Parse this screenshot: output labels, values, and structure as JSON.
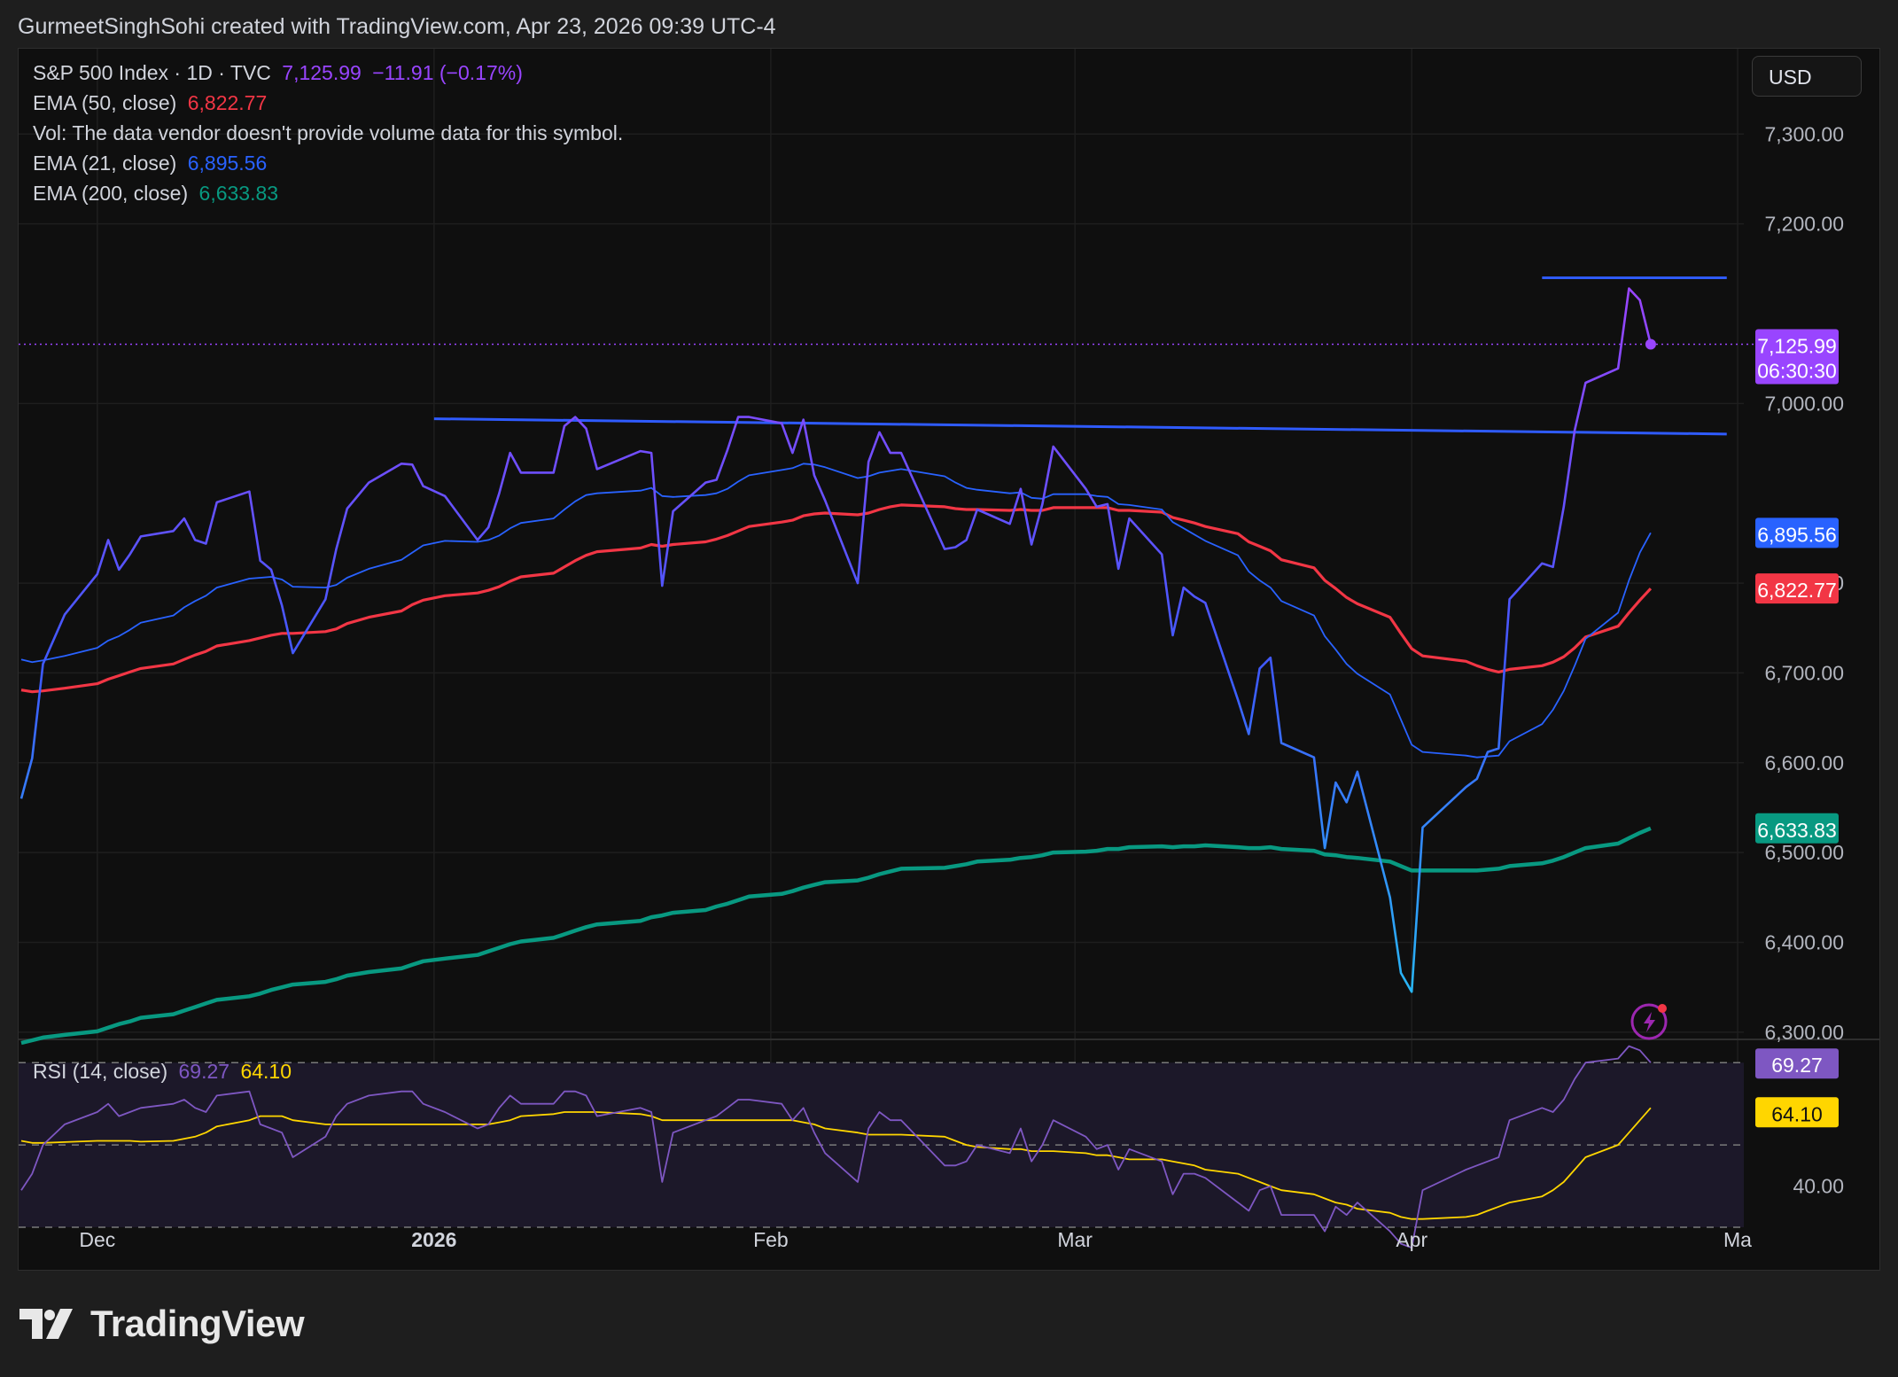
{
  "attribution": "GurmeetSinghSohi created with TradingView.com, Apr 23, 2026 09:39 UTC-4",
  "legend": {
    "symbol": "S&P 500 Index · 1D · TVC",
    "price": "7,125.99",
    "change": "−11.91 (−0.17%)",
    "ema50_label": "EMA (50, close)",
    "ema50_value": "6,822.77",
    "vol_note": "Vol: The data vendor doesn't provide volume data for this symbol.",
    "ema21_label": "EMA (21, close)",
    "ema21_value": "6,895.56",
    "ema200_label": "EMA (200, close)",
    "ema200_value": "6,633.83",
    "rsi_label": "RSI (14, close)",
    "rsi_value": "69.27",
    "rsi_ma_value": "64.10"
  },
  "currency": "USD",
  "price_tags": {
    "last_price": "7,125.99",
    "countdown": "06:30:30",
    "ema21": "6,895.56",
    "ema50": "6,822.77",
    "ema200": "6,633.83",
    "rsi": "69.27",
    "rsi_ma": "64.10"
  },
  "footer_brand": "TradingView",
  "colors": {
    "price": "#9945ff",
    "ema21": "#2962ff",
    "ema50": "#f23645",
    "ema200": "#089981",
    "rsi": "#7e57c2",
    "rsi_ma": "#ffd600",
    "trendline": "#2f5bff"
  },
  "chart_data": [
    {
      "type": "line",
      "title": "S&P 500 Index · 1D · TVC",
      "x": [
        "2025-11-24",
        "2025-11-25",
        "2025-11-26",
        "2025-11-28",
        "2025-12-01",
        "2025-12-02",
        "2025-12-03",
        "2025-12-04",
        "2025-12-05",
        "2025-12-08",
        "2025-12-09",
        "2025-12-10",
        "2025-12-11",
        "2025-12-12",
        "2025-12-15",
        "2025-12-16",
        "2025-12-17",
        "2025-12-18",
        "2025-12-19",
        "2025-12-22",
        "2025-12-23",
        "2025-12-24",
        "2025-12-26",
        "2025-12-29",
        "2025-12-30",
        "2025-12-31",
        "2026-01-02",
        "2026-01-05",
        "2026-01-06",
        "2026-01-07",
        "2026-01-08",
        "2026-01-09",
        "2026-01-12",
        "2026-01-13",
        "2026-01-14",
        "2026-01-15",
        "2026-01-16",
        "2026-01-20",
        "2026-01-21",
        "2026-01-22",
        "2026-01-23",
        "2026-01-26",
        "2026-01-27",
        "2026-01-28",
        "2026-01-29",
        "2026-01-30",
        "2026-02-02",
        "2026-02-03",
        "2026-02-04",
        "2026-02-05",
        "2026-02-06",
        "2026-02-09",
        "2026-02-10",
        "2026-02-11",
        "2026-02-12",
        "2026-02-13",
        "2026-02-17",
        "2026-02-18",
        "2026-02-19",
        "2026-02-20",
        "2026-02-23",
        "2026-02-24",
        "2026-02-25",
        "2026-02-26",
        "2026-02-27",
        "2026-03-02",
        "2026-03-03",
        "2026-03-04",
        "2026-03-05",
        "2026-03-06",
        "2026-03-09",
        "2026-03-10",
        "2026-03-11",
        "2026-03-12",
        "2026-03-13",
        "2026-03-16",
        "2026-03-17",
        "2026-03-18",
        "2026-03-19",
        "2026-03-20",
        "2026-03-23",
        "2026-03-24",
        "2026-03-25",
        "2026-03-26",
        "2026-03-27",
        "2026-03-30",
        "2026-03-31",
        "2026-04-01",
        "2026-04-02",
        "2026-04-06",
        "2026-04-07",
        "2026-04-08",
        "2026-04-09",
        "2026-04-10",
        "2026-04-13",
        "2026-04-14",
        "2026-04-15",
        "2026-04-16",
        "2026-04-17",
        "2026-04-20",
        "2026-04-21",
        "2026-04-22",
        "2026-04-23"
      ],
      "x_ticks": [
        "Dec",
        "2026",
        "Feb",
        "Mar",
        "Apr",
        "Ma"
      ],
      "x_tick_dates": [
        "2025-12-01",
        "2026-01-01",
        "2026-02-01",
        "2026-03-01",
        "2026-04-01",
        "2026-05-01"
      ],
      "x_range": [
        "2025-11-24",
        "2026-05-01"
      ],
      "ylim": [
        6290,
        7395
      ],
      "y_ticks": [
        6300,
        6400,
        6500,
        6600,
        6700,
        6800,
        7000,
        7200,
        7300
      ],
      "y_tick_labels": [
        "6,300.00",
        "6,400.00",
        "6,500.00",
        "6,600.00",
        "6,700.00",
        "6,800.00",
        "7,000.00",
        "7,200.00",
        "7,300.00"
      ],
      "series": [
        {
          "name": "S&P 500 Index",
          "values": [
            6560,
            6605,
            6710,
            6765,
            6810,
            6848,
            6815,
            6832,
            6852,
            6858,
            6872,
            6848,
            6844,
            6890,
            6902,
            6825,
            6815,
            6775,
            6722,
            6782,
            6838,
            6883,
            6912,
            6933,
            6932,
            6908,
            6897,
            6848,
            6862,
            6900,
            6945,
            6923,
            6923,
            6975,
            6985,
            6972,
            6927,
            6947,
            6945,
            6797,
            6880,
            6912,
            6915,
            6948,
            6985,
            6985,
            6978,
            6945,
            6982,
            6920,
            6892,
            6800,
            6935,
            6968,
            6945,
            6945,
            6838,
            6840,
            6848,
            6882,
            6866,
            6905,
            6843,
            6888,
            6952,
            6905,
            6885,
            6888,
            6816,
            6872,
            6832,
            6742,
            6795,
            6785,
            6778,
            6670,
            6632,
            6705,
            6717,
            6622,
            6606,
            6505,
            6578,
            6556,
            6590,
            6450,
            6366,
            6345,
            6528,
            6573,
            6582,
            6612,
            6616,
            6782,
            6822,
            6818,
            6885,
            6970,
            7023,
            7039,
            7128,
            7115,
            7066,
            7137,
            7126
          ],
          "color": "#9945ff"
        },
        {
          "name": "EMA (21, close)",
          "values": [
            6715,
            6712,
            6714,
            6719,
            6728,
            6736,
            6741,
            6748,
            6756,
            6764,
            6773,
            6780,
            6786,
            6795,
            6805,
            6806,
            6807,
            6804,
            6796,
            6795,
            6798,
            6806,
            6816,
            6826,
            6834,
            6842,
            6847,
            6846,
            6848,
            6853,
            6861,
            6867,
            6872,
            6882,
            6891,
            6898,
            6900,
            6903,
            6906,
            6897,
            6896,
            6898,
            6900,
            6905,
            6913,
            6920,
            6926,
            6928,
            6933,
            6932,
            6929,
            6917,
            6919,
            6923,
            6925,
            6927,
            6919,
            6912,
            6906,
            6904,
            6900,
            6901,
            6895,
            6894,
            6899,
            6899,
            6897,
            6896,
            6888,
            6887,
            6882,
            6868,
            6861,
            6854,
            6847,
            6831,
            6813,
            6803,
            6795,
            6780,
            6764,
            6741,
            6726,
            6710,
            6699,
            6676,
            6648,
            6620,
            6612,
            6608,
            6606,
            6607,
            6608,
            6624,
            6643,
            6659,
            6680,
            6708,
            6738,
            6767,
            6803,
            6834,
            6856,
            6882,
            6896
          ],
          "color": "#2962ff"
        },
        {
          "name": "EMA (50, close)",
          "values": [
            6681,
            6679,
            6680,
            6683,
            6688,
            6693,
            6697,
            6701,
            6705,
            6710,
            6715,
            6720,
            6724,
            6730,
            6736,
            6739,
            6742,
            6744,
            6744,
            6746,
            6749,
            6755,
            6762,
            6769,
            6776,
            6781,
            6786,
            6789,
            6792,
            6796,
            6802,
            6807,
            6811,
            6818,
            6825,
            6831,
            6835,
            6839,
            6843,
            6841,
            6843,
            6846,
            6849,
            6853,
            6858,
            6863,
            6868,
            6870,
            6875,
            6877,
            6878,
            6876,
            6878,
            6882,
            6885,
            6887,
            6885,
            6883,
            6882,
            6882,
            6881,
            6882,
            6881,
            6881,
            6884,
            6884,
            6884,
            6884,
            6881,
            6881,
            6879,
            6873,
            6870,
            6867,
            6863,
            6855,
            6846,
            6841,
            6836,
            6826,
            6817,
            6803,
            6794,
            6784,
            6777,
            6762,
            6744,
            6727,
            6719,
            6713,
            6708,
            6704,
            6701,
            6704,
            6708,
            6712,
            6718,
            6728,
            6740,
            6752,
            6767,
            6781,
            6794,
            6809,
            6823
          ],
          "color": "#f23645"
        },
        {
          "name": "EMA (200, close)",
          "values": [
            6288,
            6291,
            6294,
            6297,
            6301,
            6305,
            6309,
            6312,
            6316,
            6320,
            6324,
            6328,
            6332,
            6336,
            6340,
            6343,
            6347,
            6350,
            6353,
            6356,
            6359,
            6363,
            6367,
            6371,
            6375,
            6379,
            6382,
            6386,
            6390,
            6394,
            6398,
            6401,
            6405,
            6409,
            6413,
            6417,
            6420,
            6424,
            6428,
            6430,
            6433,
            6436,
            6440,
            6443,
            6447,
            6451,
            6454,
            6457,
            6461,
            6464,
            6467,
            6469,
            6472,
            6476,
            6479,
            6482,
            6483,
            6485,
            6487,
            6490,
            6492,
            6494,
            6495,
            6497,
            6500,
            6501,
            6502,
            6504,
            6504,
            6506,
            6507,
            6506,
            6507,
            6507,
            6508,
            6506,
            6505,
            6505,
            6506,
            6504,
            6502,
            6498,
            6497,
            6495,
            6494,
            6490,
            6485,
            6480,
            6480,
            6480,
            6480,
            6481,
            6482,
            6485,
            6488,
            6491,
            6495,
            6500,
            6505,
            6510,
            6516,
            6522,
            6527,
            6534,
            6540
          ],
          "color": "#089981"
        }
      ],
      "trendlines": [
        {
          "from": [
            "2026-01-01",
            6983
          ],
          "to": [
            "2026-04-30",
            6966
          ],
          "color": "#2f5bff"
        },
        {
          "from": [
            "2026-04-13",
            7140
          ],
          "to": [
            "2026-04-30",
            7140
          ],
          "color": "#2f5bff"
        }
      ]
    },
    {
      "type": "line",
      "title": "RSI (14, close)",
      "ylim": [
        30,
        75
      ],
      "y_ticks": [
        40
      ],
      "y_tick_labels": [
        "40.00"
      ],
      "bands": [
        30,
        50,
        70
      ],
      "series": [
        {
          "name": "RSI (14, close)",
          "values": [
            39,
            43,
            50,
            55,
            58,
            60,
            57,
            58,
            59,
            60,
            61,
            59,
            58,
            62,
            63,
            55,
            54,
            53,
            47,
            52,
            57,
            60,
            62,
            63,
            63,
            60,
            58,
            54,
            55,
            59,
            62,
            60,
            60,
            63,
            63,
            62,
            57,
            59,
            58,
            41,
            53,
            56,
            57,
            59,
            61,
            61,
            60,
            56,
            59,
            53,
            48,
            41,
            54,
            58,
            56,
            56,
            45,
            45,
            46,
            50,
            48,
            54,
            46,
            50,
            56,
            52,
            49,
            50,
            44,
            49,
            46,
            38,
            43,
            43,
            42,
            36,
            34,
            39,
            40,
            33,
            33,
            29,
            35,
            33,
            36,
            29,
            26,
            25,
            39,
            44,
            45,
            46,
            47,
            56,
            59,
            58,
            61,
            66,
            70,
            71,
            74,
            73,
            70,
            73,
            69.27
          ],
          "color": "#7e57c2"
        },
        {
          "name": "RSI (14, close) MA",
          "values": [
            51,
            50.5,
            50.5,
            50.7,
            51,
            51,
            51,
            51,
            50.8,
            51,
            51.5,
            52,
            53,
            54.5,
            56,
            57,
            57,
            57,
            56,
            55,
            55,
            55,
            55,
            55,
            55,
            55,
            55,
            55,
            55,
            55.5,
            56,
            57,
            57.5,
            58,
            58,
            58,
            58,
            57.5,
            57,
            56,
            56,
            56,
            56,
            56,
            56,
            56,
            56,
            56,
            55.5,
            55,
            54,
            53,
            52.5,
            52.5,
            52.5,
            52.5,
            52,
            51,
            50,
            49.5,
            49,
            49,
            48.5,
            48.5,
            48.5,
            48,
            47.5,
            47.5,
            47,
            46.5,
            46.5,
            46,
            45.5,
            45,
            44,
            43,
            42,
            41,
            40,
            39,
            38,
            37,
            36,
            35.5,
            34.5,
            33.5,
            32.5,
            32,
            32,
            32.5,
            33,
            34,
            35,
            36,
            37.5,
            39,
            41,
            44,
            47,
            50,
            53,
            56,
            59,
            61,
            62,
            63.5,
            64.1
          ],
          "color": "#ffd600"
        }
      ]
    }
  ]
}
